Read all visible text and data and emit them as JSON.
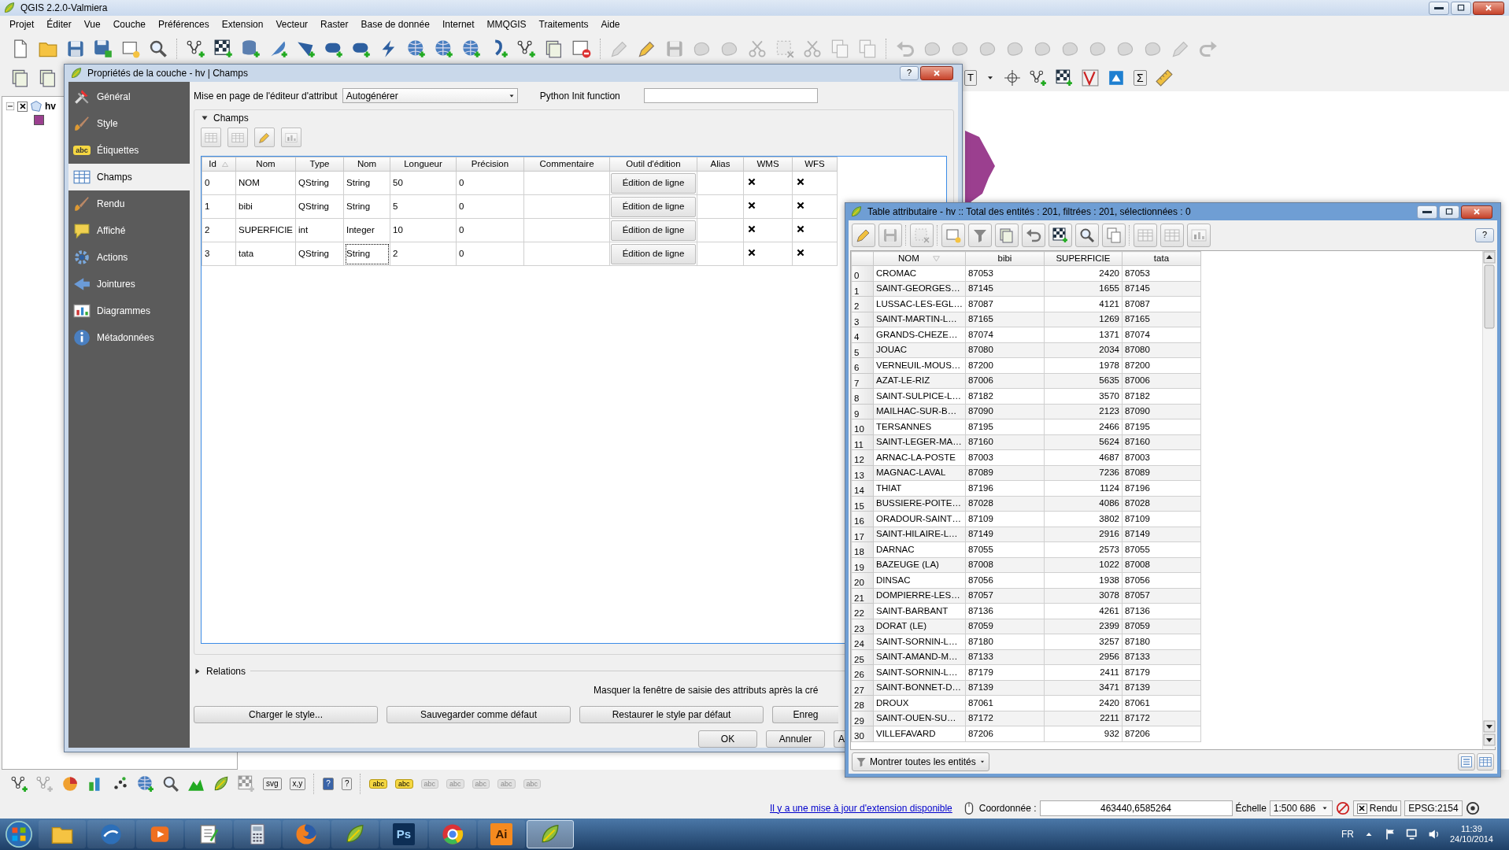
{
  "window": {
    "title": "QGIS 2.2.0-Valmiera"
  },
  "menu": [
    "Projet",
    "Éditer",
    "Vue",
    "Couche",
    "Préférences",
    "Extension",
    "Vecteur",
    "Raster",
    "Base de donnée",
    "Internet",
    "MMQGIS",
    "Traitements",
    "Aide"
  ],
  "toolbar2": {
    "annotation_text": "T",
    "statistics_text": "Σ"
  },
  "layers_panel": {
    "layers": [
      {
        "name": "hv",
        "checked": true,
        "expanded": true,
        "color": "#9b3f8f"
      }
    ]
  },
  "properties_dialog": {
    "title": "Propriétés de la couche - hv | Champs",
    "help_button": "?",
    "sidebar": [
      {
        "label": "Général",
        "selected": false
      },
      {
        "label": "Style",
        "selected": false
      },
      {
        "label": "Étiquettes",
        "icon_text": "abc",
        "selected": false
      },
      {
        "label": "Champs",
        "selected": true
      },
      {
        "label": "Rendu",
        "selected": false
      },
      {
        "label": "Affiché",
        "selected": false
      },
      {
        "label": "Actions",
        "selected": false
      },
      {
        "label": "Jointures",
        "selected": false
      },
      {
        "label": "Diagrammes",
        "selected": false
      },
      {
        "label": "Métadonnées",
        "selected": false
      }
    ],
    "layout_label": "Mise en page de l'éditeur d'attribut",
    "layout_value": "Autogénérer",
    "python_label": "Python Init function",
    "fields_group": {
      "title": "Champs",
      "expanded": true,
      "columns": [
        {
          "label": "Id",
          "sorted": true
        },
        {
          "label": "Nom",
          "sorted": false
        },
        {
          "label": "Type",
          "sorted": false
        },
        {
          "label": "Nom",
          "sorted": false
        },
        {
          "label": "Longueur",
          "sorted": false
        },
        {
          "label": "Précision",
          "sorted": false
        },
        {
          "label": "Commentaire",
          "sorted": false
        },
        {
          "label": "Outil d'édition",
          "sorted": false
        },
        {
          "label": "Alias",
          "sorted": false
        },
        {
          "label": "WMS",
          "sorted": false
        },
        {
          "label": "WFS",
          "sorted": false
        }
      ],
      "rows": [
        {
          "id": "0",
          "name": "NOM",
          "type": "QString",
          "type_name": "String",
          "length": "50",
          "precision": "0",
          "edit_widget": "Édition de ligne",
          "wms": true,
          "wfs": true,
          "focused": false
        },
        {
          "id": "1",
          "name": "bibi",
          "type": "QString",
          "type_name": "String",
          "length": "5",
          "precision": "0",
          "edit_widget": "Édition de ligne",
          "wms": true,
          "wfs": true,
          "focused": false
        },
        {
          "id": "2",
          "name": "SUPERFICIE",
          "type": "int",
          "type_name": "Integer",
          "length": "10",
          "precision": "0",
          "edit_widget": "Édition de ligne",
          "wms": true,
          "wfs": true,
          "focused": false
        },
        {
          "id": "3",
          "name": "tata",
          "type": "QString",
          "type_name": "String",
          "length": "2",
          "precision": "0",
          "edit_widget": "Édition de ligne",
          "wms": true,
          "wfs": true,
          "focused": true
        }
      ]
    },
    "relations_group": {
      "title": "Relations",
      "expanded": false
    },
    "hide_form_label": "Masquer la fenêtre de saisie des attributs après la cré",
    "style_buttons": [
      "Charger le style...",
      "Sauvegarder comme défaut",
      "Restaurer le style par défaut",
      "Enreg"
    ],
    "dialog_buttons": [
      "OK",
      "Annuler",
      "A"
    ]
  },
  "attribute_table": {
    "title": "Table attributaire - hv :: Total des entités : 201, filtrées : 201, sélectionnées : 0",
    "help_button": "?",
    "columns": [
      {
        "label": "NOM",
        "sorted": true
      },
      {
        "label": "bibi",
        "sorted": false
      },
      {
        "label": "SUPERFICIE",
        "sorted": false
      },
      {
        "label": "tata",
        "sorted": false
      }
    ],
    "rows": [
      {
        "index": "0",
        "cells": [
          "CROMAC",
          "87053",
          "2420",
          "87053"
        ]
      },
      {
        "index": "1",
        "cells": [
          "SAINT-GEORGES…",
          "87145",
          "1655",
          "87145"
        ]
      },
      {
        "index": "2",
        "cells": [
          "LUSSAC-LES-EGL…",
          "87087",
          "4121",
          "87087"
        ]
      },
      {
        "index": "3",
        "cells": [
          "SAINT-MARTIN-L…",
          "87165",
          "1269",
          "87165"
        ]
      },
      {
        "index": "4",
        "cells": [
          "GRANDS-CHEZE…",
          "87074",
          "1371",
          "87074"
        ]
      },
      {
        "index": "5",
        "cells": [
          "JOUAC",
          "87080",
          "2034",
          "87080"
        ]
      },
      {
        "index": "6",
        "cells": [
          "VERNEUIL-MOUS…",
          "87200",
          "1978",
          "87200"
        ]
      },
      {
        "index": "7",
        "cells": [
          "AZAT-LE-RIZ",
          "87006",
          "5635",
          "87006"
        ]
      },
      {
        "index": "8",
        "cells": [
          "SAINT-SULPICE-L…",
          "87182",
          "3570",
          "87182"
        ]
      },
      {
        "index": "9",
        "cells": [
          "MAILHAC-SUR-B…",
          "87090",
          "2123",
          "87090"
        ]
      },
      {
        "index": "10",
        "cells": [
          "TERSANNES",
          "87195",
          "2466",
          "87195"
        ]
      },
      {
        "index": "11",
        "cells": [
          "SAINT-LEGER-MA…",
          "87160",
          "5624",
          "87160"
        ]
      },
      {
        "index": "12",
        "cells": [
          "ARNAC-LA-POSTE",
          "87003",
          "4687",
          "87003"
        ]
      },
      {
        "index": "13",
        "cells": [
          "MAGNAC-LAVAL",
          "87089",
          "7236",
          "87089"
        ]
      },
      {
        "index": "14",
        "cells": [
          "THIAT",
          "87196",
          "1124",
          "87196"
        ]
      },
      {
        "index": "15",
        "cells": [
          "BUSSIERE-POITE…",
          "87028",
          "4086",
          "87028"
        ]
      },
      {
        "index": "16",
        "cells": [
          "ORADOUR-SAINT…",
          "87109",
          "3802",
          "87109"
        ]
      },
      {
        "index": "17",
        "cells": [
          "SAINT-HILAIRE-L…",
          "87149",
          "2916",
          "87149"
        ]
      },
      {
        "index": "18",
        "cells": [
          "DARNAC",
          "87055",
          "2573",
          "87055"
        ]
      },
      {
        "index": "19",
        "cells": [
          "BAZEUGE (LA)",
          "87008",
          "1022",
          "87008"
        ]
      },
      {
        "index": "20",
        "cells": [
          "DINSAC",
          "87056",
          "1938",
          "87056"
        ]
      },
      {
        "index": "21",
        "cells": [
          "DOMPIERRE-LES…",
          "87057",
          "3078",
          "87057"
        ]
      },
      {
        "index": "22",
        "cells": [
          "SAINT-BARBANT",
          "87136",
          "4261",
          "87136"
        ]
      },
      {
        "index": "23",
        "cells": [
          "DORAT (LE)",
          "87059",
          "2399",
          "87059"
        ]
      },
      {
        "index": "24",
        "cells": [
          "SAINT-SORNIN-L…",
          "87180",
          "3257",
          "87180"
        ]
      },
      {
        "index": "25",
        "cells": [
          "SAINT-AMAND-M…",
          "87133",
          "2956",
          "87133"
        ]
      },
      {
        "index": "26",
        "cells": [
          "SAINT-SORNIN-L…",
          "87179",
          "2411",
          "87179"
        ]
      },
      {
        "index": "27",
        "cells": [
          "SAINT-BONNET-D…",
          "87139",
          "3471",
          "87139"
        ]
      },
      {
        "index": "28",
        "cells": [
          "DROUX",
          "87061",
          "2420",
          "87061"
        ]
      },
      {
        "index": "29",
        "cells": [
          "SAINT-OUEN-SU…",
          "87172",
          "2211",
          "87172"
        ]
      },
      {
        "index": "30",
        "cells": [
          "VILLEFAVARD",
          "87206",
          "932",
          "87206"
        ]
      }
    ],
    "filter_button": "Montrer toutes les entités"
  },
  "bottom_toolbar": {
    "svg_text": "svg",
    "xy_text": "x,y",
    "help_text": "?",
    "whats_this_text": "?",
    "label_tool_texts": [
      "abc",
      "abc",
      "abc",
      "abc",
      "abc",
      "abc",
      "abc"
    ]
  },
  "status_bar": {
    "update_link": "Il y a une mise à jour d'extension disponible",
    "coordinate_label": "Coordonnée :",
    "coordinate_value": "463440,6585264",
    "scale_label": "Échelle",
    "scale_value": "1:500 686",
    "render": {
      "label": "Rendu",
      "checked": true
    },
    "crs": "EPSG:2154"
  },
  "taskbar": {
    "apps": [
      {
        "kind": "folder",
        "selected": false
      },
      {
        "kind": "mail",
        "selected": false
      },
      {
        "kind": "media",
        "selected": false
      },
      {
        "kind": "notepad",
        "selected": false
      },
      {
        "kind": "calculator",
        "selected": false
      },
      {
        "kind": "firefox",
        "selected": false
      },
      {
        "kind": "qgis",
        "selected": false
      },
      {
        "kind": "tile",
        "text": "Ps",
        "color": "#0d2e55",
        "selected": false
      },
      {
        "kind": "chrome",
        "selected": false
      },
      {
        "kind": "tile",
        "text": "Ai",
        "color": "#f58a1f",
        "selected": false
      },
      {
        "kind": "qgis",
        "selected": true
      }
    ],
    "tray": {
      "language": "FR",
      "time": "11:39",
      "date": "24/10/2014"
    }
  }
}
